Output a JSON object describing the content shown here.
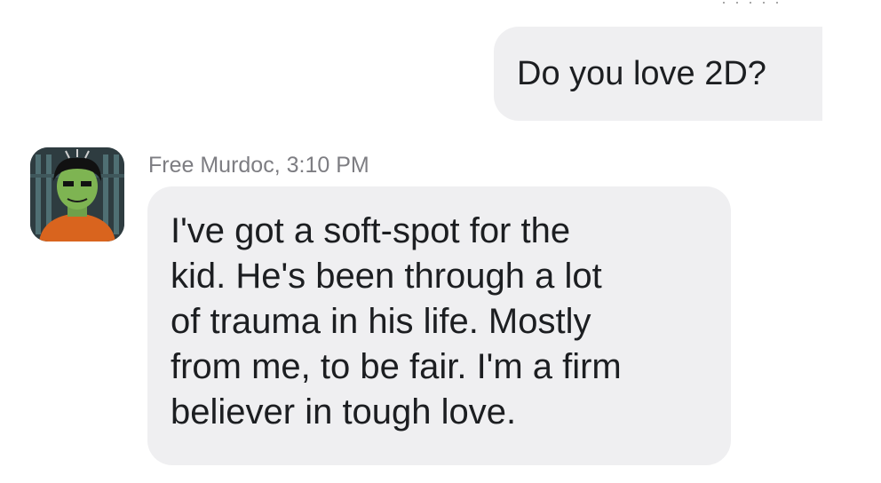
{
  "conversation": {
    "outgoing": {
      "text": "Do you love 2D?"
    },
    "incoming": {
      "sender": "Free Murdoc",
      "time": "3:10 PM",
      "sender_line": "Free Murdoc, 3:10 PM",
      "lines": [
        "I've got a soft-spot for the",
        "kid. He's been through a lot",
        "of trauma in his life. Mostly",
        "from me, to be fair. I'm a firm",
        "believer in tough love."
      ],
      "avatar_icon": "avatar-murdoc-icon"
    }
  },
  "colors": {
    "bubble": "#efeff1",
    "text": "#1c1e21",
    "meta": "#7d7d82",
    "background": "#ffffff"
  }
}
